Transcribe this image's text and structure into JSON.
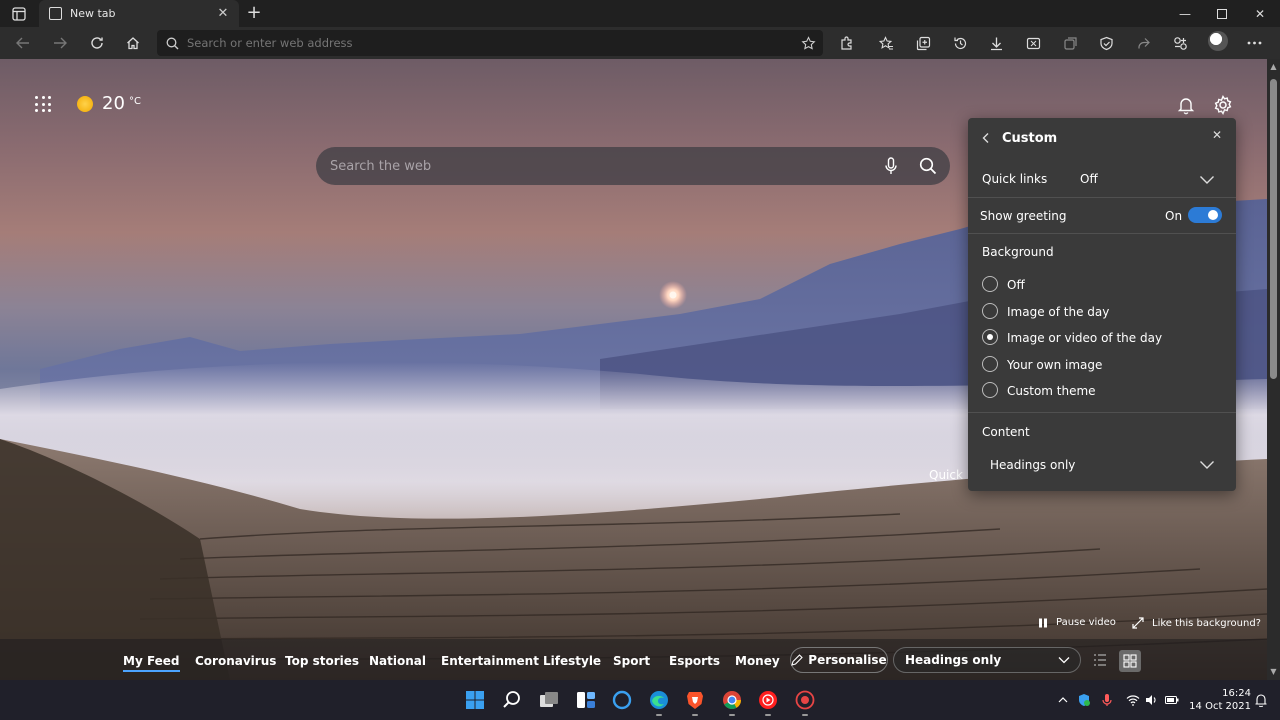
{
  "browser": {
    "tab_title": "New tab",
    "address_placeholder": "Search or enter web address"
  },
  "weather": {
    "temperature": "20",
    "unit": "°C"
  },
  "search": {
    "placeholder": "Search the web"
  },
  "quick_links_partial": "Quick li",
  "panel": {
    "title": "Custom",
    "quick_links": {
      "label": "Quick links",
      "value": "Off"
    },
    "show_greeting": {
      "label": "Show greeting",
      "value": "On",
      "enabled": true
    },
    "background": {
      "label": "Background",
      "options": [
        {
          "label": "Off",
          "selected": false
        },
        {
          "label": "Image of the day",
          "selected": false
        },
        {
          "label": "Image or video of the day",
          "selected": true
        },
        {
          "label": "Your own image",
          "selected": false
        },
        {
          "label": "Custom theme",
          "selected": false
        }
      ]
    },
    "content": {
      "label": "Content",
      "value": "Headings only"
    }
  },
  "media": {
    "pause": "Pause video",
    "like": "Like this background?"
  },
  "feed_nav": {
    "items": [
      "My Feed",
      "Coronavirus",
      "Top stories",
      "National",
      "Entertainment",
      "Lifestyle",
      "Sport",
      "Esports",
      "Money"
    ],
    "active": "My Feed",
    "personalise": "Personalise",
    "headings": "Headings only"
  },
  "clock": {
    "time": "16:24",
    "date": "14 Oct 2021"
  },
  "colors": {
    "accent": "#2c7bd6",
    "nav_underline": "#4ca4ff",
    "panel_bg": "#3a3a3a"
  }
}
